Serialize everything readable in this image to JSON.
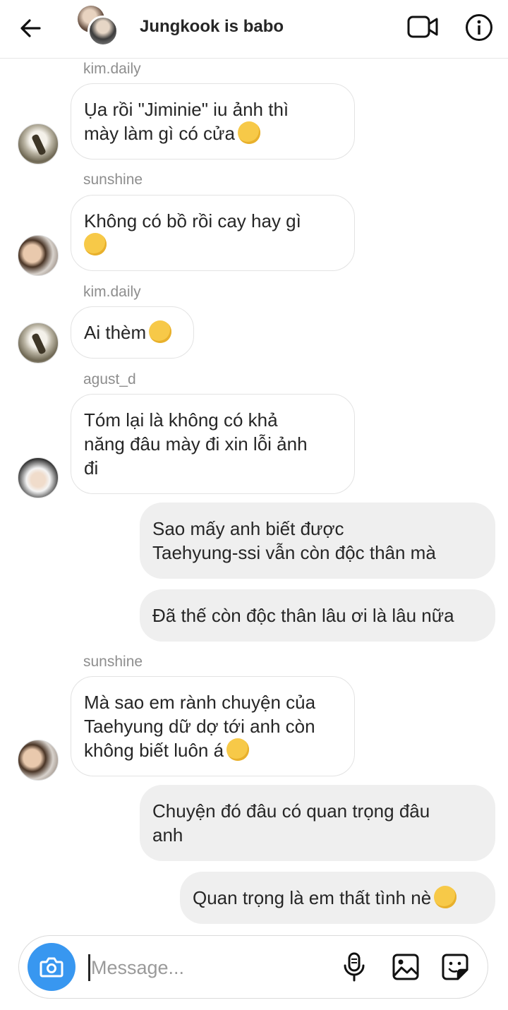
{
  "header": {
    "title": "Jungkook is babo",
    "back_icon": "arrow-left-icon",
    "video_icon": "video-call-icon",
    "info_icon": "info-icon"
  },
  "messages": [
    {
      "sender": "kim.daily",
      "text": "Ụa rồi \"Jiminie\" iu ảnh thì\nmày làm gì có cửa",
      "emoji": "smirking-face"
    },
    {
      "sender": "sunshine",
      "text": "Không có bồ rồi cay hay gì\n",
      "emoji": "smirking-face"
    },
    {
      "sender": "kim.daily",
      "text": "Ai thèm",
      "emoji": "unamused-face"
    },
    {
      "sender": "agust_d",
      "text": "Tóm lại là không có khả\nnăng đâu mày đi xin lỗi ảnh\nđi",
      "emoji": ""
    },
    {
      "sender": "",
      "text": "Sao mấy anh biết được\nTaehyung-ssi vẫn còn độc thân mà",
      "emoji": ""
    },
    {
      "sender": "",
      "text": "Đã thế còn độc thân lâu ơi là lâu nữa",
      "emoji": ""
    },
    {
      "sender": "sunshine",
      "text": "Mà sao em rành chuyện của\nTaehyung dữ dợ tới anh còn\nkhông biết luôn á",
      "emoji": "hushed-face"
    },
    {
      "sender": "",
      "text": "Chuyện đó đâu có quan trọng đâu\nanh",
      "emoji": ""
    },
    {
      "sender": "",
      "text": "Quan trọng là em thất tình nè",
      "emoji": "smiling-face-with-tear"
    }
  ],
  "composer": {
    "placeholder": "Message...",
    "value": "",
    "camera_icon": "camera-icon",
    "mic_icon": "microphone-icon",
    "gallery_icon": "image-gallery-icon",
    "sticker_icon": "sticker-icon",
    "accent_color": "#3897f0"
  },
  "colors": {
    "incoming_bubble": "#ffffff",
    "outgoing_bubble": "#efefef",
    "sender_name": "#8e8e8e"
  }
}
